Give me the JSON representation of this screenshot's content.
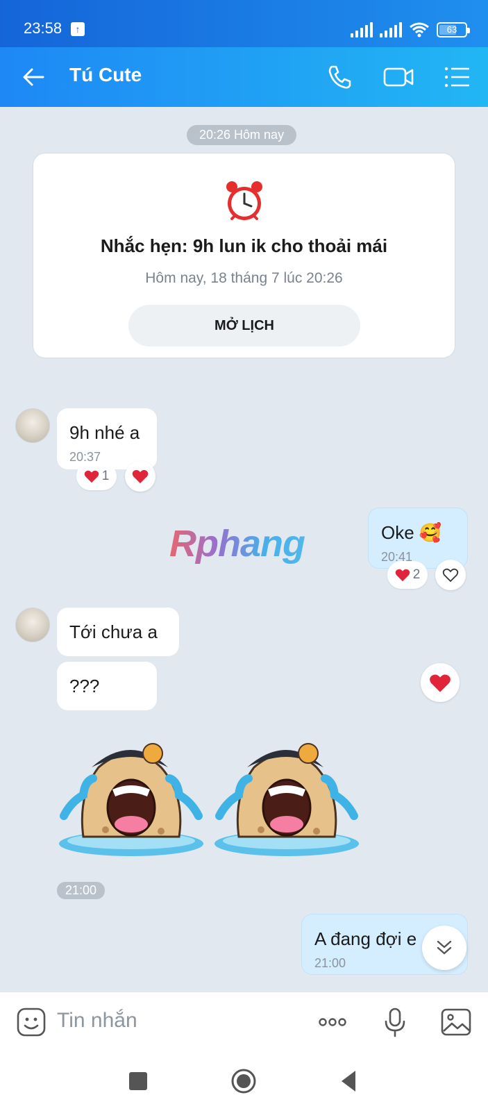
{
  "status_bar": {
    "time": "23:58",
    "battery": "63"
  },
  "header": {
    "title": "Tú Cute"
  },
  "date_pill": "20:26 Hôm nay",
  "reminder": {
    "title": "Nhắc hẹn: 9h lun ik cho thoải mái",
    "subtitle": "Hôm nay, 18 tháng 7 lúc 20:26",
    "button": "MỞ LỊCH"
  },
  "messages": [
    {
      "text": "9h nhé a",
      "time": "20:37",
      "reaction_count": "1"
    },
    {
      "text": "Oke 🥰",
      "time": "20:41",
      "reaction_count": "2"
    },
    {
      "text": "Tới chưa a"
    },
    {
      "text": "???"
    },
    {
      "time": "21:00"
    },
    {
      "text": "A đang đợi e",
      "time": "21:00"
    }
  ],
  "watermark": "Rphang",
  "input": {
    "placeholder": "Tin nhắn"
  },
  "colors": {
    "accent": "#1e88f5",
    "out_bubble": "#d5eeff",
    "heart": "#e0243a"
  }
}
